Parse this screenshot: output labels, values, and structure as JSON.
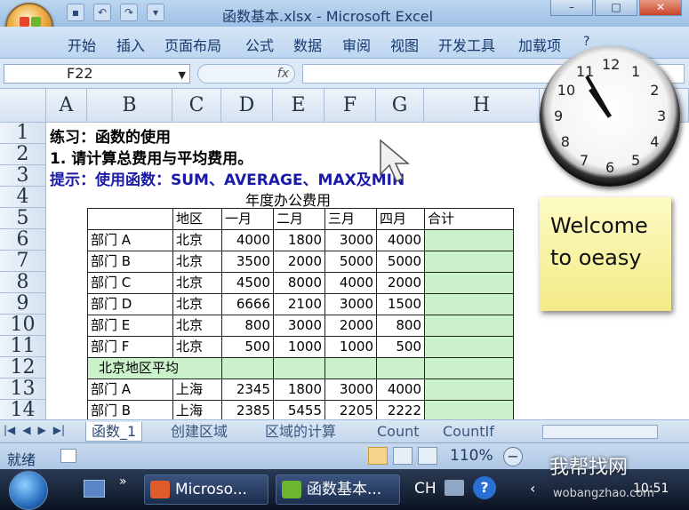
{
  "window": {
    "title": "函数基本.xlsx - Microsoft Excel"
  },
  "ribbon": {
    "tabs": [
      "开始",
      "插入",
      "页面布局",
      "公式",
      "数据",
      "审阅",
      "视图",
      "开发工具",
      "加载项"
    ]
  },
  "formula_bar": {
    "name_box": "F22",
    "fx": "fx",
    "value": ""
  },
  "columns": [
    "A",
    "B",
    "C",
    "D",
    "E",
    "F",
    "G",
    "H"
  ],
  "rows": [
    "1",
    "2",
    "3",
    "4",
    "5",
    "6",
    "7",
    "8",
    "9",
    "10",
    "11",
    "12",
    "13",
    "14"
  ],
  "sheet": {
    "r1": "练习：函数的使用",
    "r2": "1. 请计算总费用与平均费用。",
    "r3": "提示：使用函数：SUM、AVERAGE、MAX及MIN",
    "r4": "年度办公费用",
    "header": [
      "",
      "地区",
      "一月",
      "二月",
      "三月",
      "四月",
      "合计"
    ],
    "data": [
      [
        "部门 A",
        "北京",
        "4000",
        "1800",
        "3000",
        "4000",
        ""
      ],
      [
        "部门 B",
        "北京",
        "3500",
        "2000",
        "5000",
        "5000",
        ""
      ],
      [
        "部门 C",
        "北京",
        "4500",
        "8000",
        "4000",
        "2000",
        ""
      ],
      [
        "部门 D",
        "北京",
        "6666",
        "2100",
        "3000",
        "1500",
        ""
      ],
      [
        "部门 E",
        "北京",
        "800",
        "3000",
        "2000",
        "800",
        ""
      ],
      [
        "部门 F",
        "北京",
        "500",
        "1000",
        "1000",
        "500",
        ""
      ]
    ],
    "r12": "北京地区平均",
    "data2": [
      [
        "部门 A",
        "上海",
        "2345",
        "1800",
        "3000",
        "4000",
        ""
      ],
      [
        "部门 B",
        "上海",
        "2385",
        "5455",
        "2205",
        "2222",
        ""
      ]
    ]
  },
  "sheet_tabs": [
    "函数_1",
    "创建区域",
    "区域的计算",
    "Count",
    "CountIf"
  ],
  "status": {
    "ready": "就绪",
    "zoom": "110%"
  },
  "taskbar": {
    "btn1": "Microso...",
    "btn2": "函数基本...",
    "lang": "CH",
    "time": "10:51"
  },
  "gadget": {
    "note": "Welcome to oeasy"
  },
  "watermark": {
    "logo": "我帮找网",
    "url": "wobangzhao.com"
  },
  "clock_numbers": [
    "12",
    "1",
    "2",
    "3",
    "4",
    "5",
    "6",
    "7",
    "8",
    "9",
    "10",
    "11"
  ],
  "colors": {
    "accent": "#15396e",
    "green_cell": "#ccf2cc",
    "tip_text": "#1a1aa8"
  }
}
